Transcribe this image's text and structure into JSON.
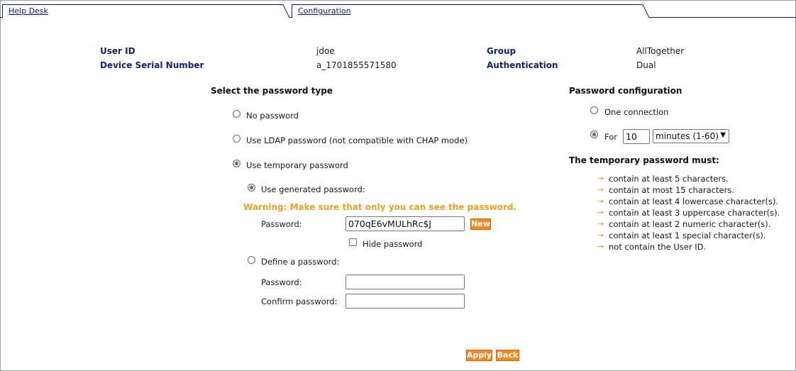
{
  "tabs": [
    {
      "label": "Help Desk"
    },
    {
      "label": "Configuration"
    }
  ],
  "user_info": {
    "user_id_label": "User ID",
    "user_id_value": "jdoe",
    "serial_label": "Device Serial Number",
    "serial_value": "a_1701855571580",
    "group_label": "Group",
    "group_value": "AllTogether",
    "auth_label": "Authentication",
    "auth_value": "Dual"
  },
  "password_type": {
    "title": "Select the password type",
    "options": [
      {
        "label": "No password",
        "selected": false
      },
      {
        "label": "Use LDAP password (not compatible with CHAP mode)",
        "selected": false
      },
      {
        "label": "Use temporary password",
        "selected": true
      }
    ],
    "generated": {
      "label": "Use generated password:",
      "selected": true,
      "warning": "Warning: Make sure that only you can see the password.",
      "password_label": "Password:",
      "password_value": "070qE6vMULhRc$J",
      "new_button": "New",
      "hide_label": "Hide password",
      "hide_checked": false
    },
    "define": {
      "label": "Define a password:",
      "selected": false,
      "password_label": "Password:",
      "password_value": "",
      "confirm_label": "Confirm password:",
      "confirm_value": ""
    }
  },
  "password_config": {
    "title": "Password configuration",
    "one_connection_label": "One connection",
    "one_connection_selected": false,
    "for_label": "For",
    "for_selected": true,
    "for_value": "10",
    "unit_selected": "minutes (1-60)"
  },
  "rules": {
    "title": "The temporary password must:",
    "items": [
      "contain at least 5 characters.",
      "contain at most 15 characters.",
      "contain at least 4 lowercase character(s).",
      "contain at least 3 uppercase character(s).",
      "contain at least 2 numeric character(s).",
      "contain at least 1 special character(s).",
      "not contain the User ID."
    ]
  },
  "actions": {
    "apply": "Apply",
    "back": "Back"
  },
  "colors": {
    "accent": "#f08a24",
    "label_navy": "#13236b",
    "warning": "#f0a020"
  }
}
